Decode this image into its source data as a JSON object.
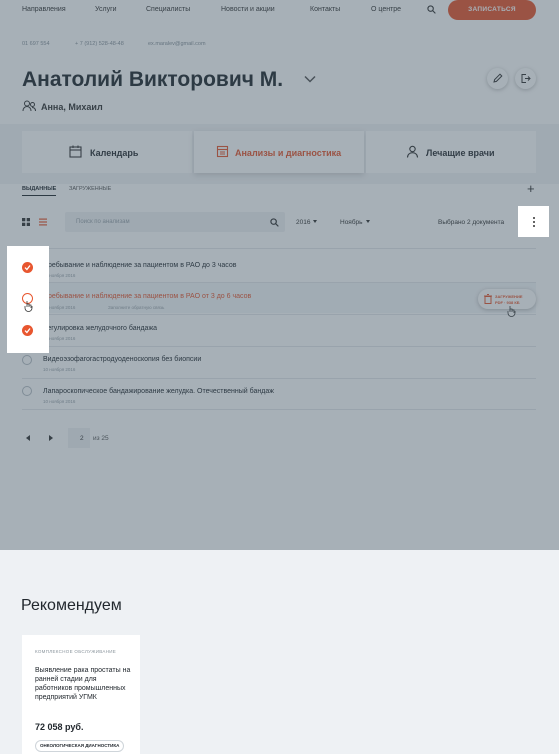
{
  "nav": {
    "items": [
      "Направления",
      "Услуги",
      "Специалисты",
      "Новости и акции",
      "Контакты",
      "О центре"
    ],
    "cta": "ЗАПИСАТЬСЯ"
  },
  "contacts": {
    "id": "01 697 554",
    "phone": "+ 7 (912) 528-48-48",
    "email": "ex.maralev@gmail.com"
  },
  "patient": {
    "name": "Анатолий Викторович М.",
    "family": "Анна, Михаил"
  },
  "tabs": [
    "Календарь",
    "Анализы и диагностика",
    "Лечащие врачи"
  ],
  "subtabs": [
    "ВЫДАННЫЕ",
    "ЗАГРУЖЕННЫЕ"
  ],
  "toolbar": {
    "search_placeholder": "Поиск по анализам",
    "year": "2016",
    "month": "Ноябрь",
    "selected_count": "Выбрано 2 документа"
  },
  "rows": [
    {
      "title": "Пребывание и наблюдение за пациентом в РАО до 3 часов",
      "date": "10 ноября 2016",
      "note": "",
      "checked": true
    },
    {
      "title": "Пребывание и наблюдение за пациентом в РАО от 3 до 6 часов",
      "date": "10 ноября 2016",
      "note": "Заполните обратную связь",
      "checked": false
    },
    {
      "title": "Регулировка желудочного бандажа",
      "date": "10 ноября 2016",
      "note": "",
      "checked": true
    },
    {
      "title": "Видеоэзофагогастродуоденоскопия без биопсии",
      "date": "10 ноября 2016",
      "note": "",
      "checked": false
    },
    {
      "title": "Лапароскопическое бандажирование желудка. Отечественный бандаж",
      "date": "10 ноября 2016",
      "note": "",
      "checked": false
    }
  ],
  "delete_pill": {
    "line1": "ЗАГРУЖЕНИЕ",
    "line2": "PDF · 938 КБ"
  },
  "pagination": {
    "current": "2",
    "of": "из 25"
  },
  "recommend": {
    "title": "Рекомендуем",
    "card": {
      "category": "КОМПЛЕКСНОЕ ОБСЛУЖИВАНИЕ",
      "text": "Выявление рака простаты на ранней стадии для работников промышленных предприятий УГМК",
      "price": "72 058 руб.",
      "tag": "ОНКОЛОГИЧЕСКАЯ ДИАГНОСТИКА"
    }
  },
  "colors": {
    "accent": "#e8562f",
    "overlay": "#3c505f",
    "text": "#22282e"
  }
}
